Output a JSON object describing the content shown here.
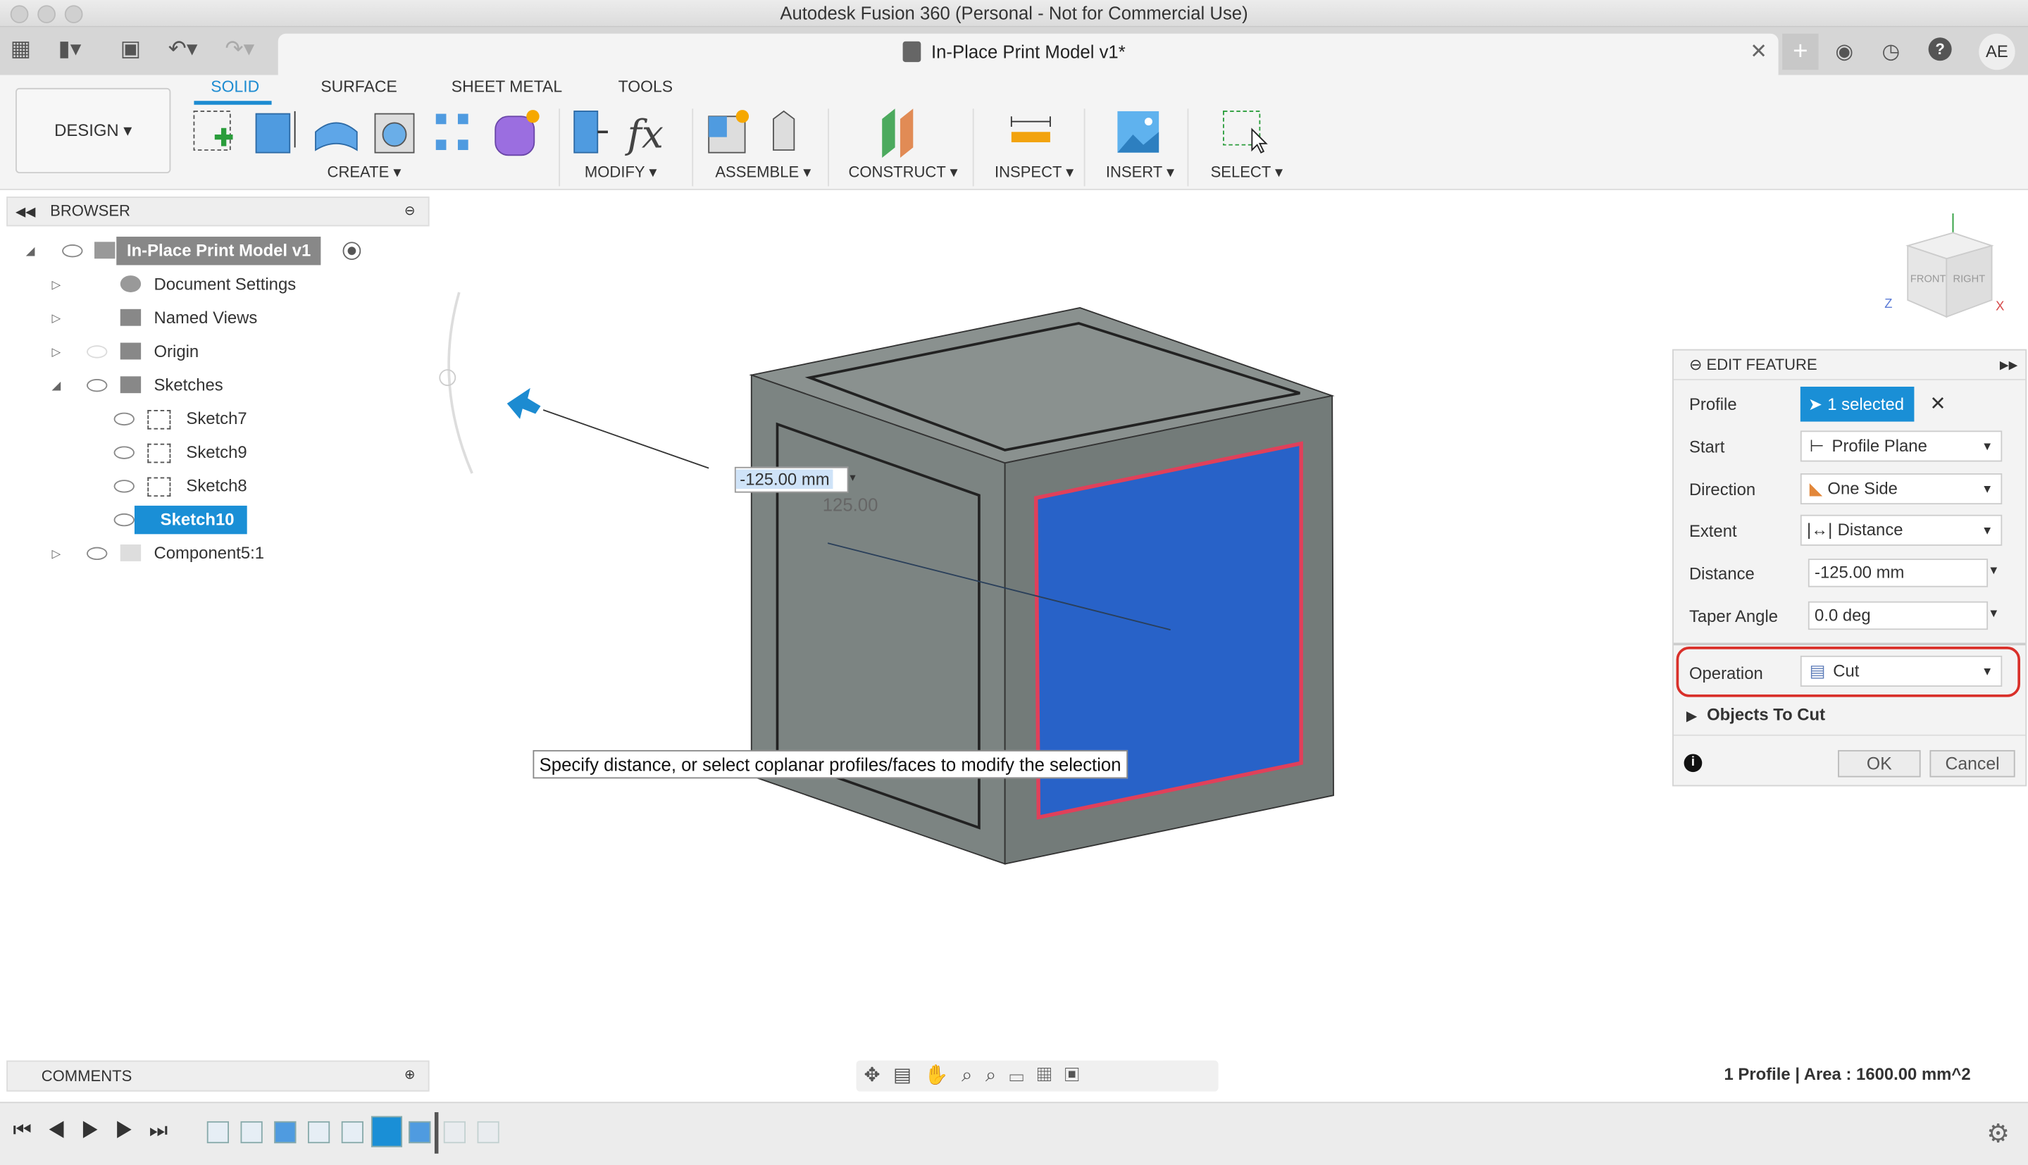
{
  "window": {
    "title": "Autodesk Fusion 360 (Personal - Not for Commercial Use)"
  },
  "doc_tab": {
    "title": "In-Place Print Model v1*",
    "user_initials": "AE"
  },
  "toolbar": {
    "workspace": "DESIGN ▾",
    "tabs": [
      {
        "label": "SOLID",
        "active": true
      },
      {
        "label": "SURFACE"
      },
      {
        "label": "SHEET METAL"
      },
      {
        "label": "TOOLS"
      }
    ],
    "groups": [
      "CREATE ▾",
      "MODIFY ▾",
      "ASSEMBLE ▾",
      "CONSTRUCT ▾",
      "INSPECT ▾",
      "INSERT ▾",
      "SELECT ▾"
    ]
  },
  "browser": {
    "title": "BROWSER",
    "items": [
      {
        "label": "In-Place Print Model v1"
      },
      {
        "label": "Document Settings"
      },
      {
        "label": "Named Views"
      },
      {
        "label": "Origin"
      },
      {
        "label": "Sketches"
      },
      {
        "label": "Sketch7"
      },
      {
        "label": "Sketch9"
      },
      {
        "label": "Sketch8"
      },
      {
        "label": "Sketch10",
        "selected": true
      },
      {
        "label": "Component5:1"
      }
    ]
  },
  "viewport": {
    "distance_input": "-125.00 mm",
    "ghost_dimension": "125.00",
    "tooltip": "Specify distance, or select coplanar profiles/faces to modify the selection",
    "viewcube": {
      "front": "FRONT",
      "right": "RIGHT",
      "axis_z": "Z",
      "axis_x": "X"
    }
  },
  "edit_feature": {
    "title": "EDIT FEATURE",
    "profile_label": "Profile",
    "profile_value": "1 selected",
    "start_label": "Start",
    "start_value": "Profile Plane",
    "direction_label": "Direction",
    "direction_value": "One Side",
    "extent_label": "Extent",
    "extent_value": "Distance",
    "distance_label": "Distance",
    "distance_value": "-125.00 mm",
    "taper_label": "Taper Angle",
    "taper_value": "0.0 deg",
    "operation_label": "Operation",
    "operation_value": "Cut",
    "objects_to_cut": "Objects To Cut",
    "ok": "OK",
    "cancel": "Cancel",
    "highlight_color": "#d9302a"
  },
  "comments": {
    "title": "COMMENTS"
  },
  "status": {
    "text": "1 Profile | Area : 1600.00 mm^2"
  },
  "colors": {
    "accent": "#1a8fd6",
    "face_blue": "#2862c8",
    "body_gray": "#7f8785"
  }
}
